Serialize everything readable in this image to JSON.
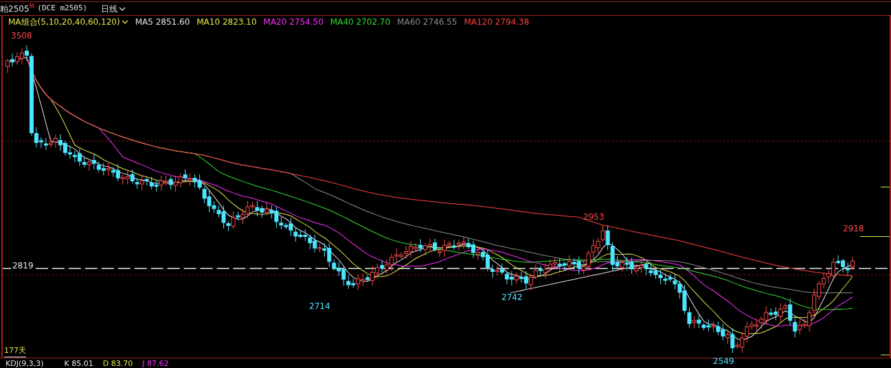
{
  "header": {
    "symbol": "粕2505",
    "flag": "M",
    "code": "(DCE m2505)",
    "period": "日线"
  },
  "ma_bar": {
    "group": "MA组合(5,10,20,40,60,120)",
    "items": [
      {
        "label": "MA5 2851.60",
        "color": "#e6e6e6"
      },
      {
        "label": "MA10 2823.10",
        "color": "#e6e64c"
      },
      {
        "label": "MA20 2754.50",
        "color": "#ff2eff"
      },
      {
        "label": "MA40 2702.70",
        "color": "#33dd33"
      },
      {
        "label": "MA60 2746.55",
        "color": "#8c8c8c"
      },
      {
        "label": "MA120 2794.38",
        "color": "#ff4040"
      }
    ]
  },
  "chart": {
    "price_labels": [
      {
        "text": "3508",
        "kind": "high"
      },
      {
        "text": "2953",
        "kind": "high"
      },
      {
        "text": "2918",
        "kind": "high"
      },
      {
        "text": "2714",
        "kind": "low"
      },
      {
        "text": "2742",
        "kind": "low"
      },
      {
        "text": "2549",
        "kind": "low"
      }
    ],
    "current_price": "2819",
    "day_count": "177天"
  },
  "indicator": {
    "name": "KDJ(9,3,3)",
    "items": [
      {
        "label": "K 85.01",
        "color": "#e6e6e6"
      },
      {
        "label": "D 83.70",
        "color": "#e6e64c"
      },
      {
        "label": "J 87.62",
        "color": "#ff2eff"
      }
    ]
  }
}
